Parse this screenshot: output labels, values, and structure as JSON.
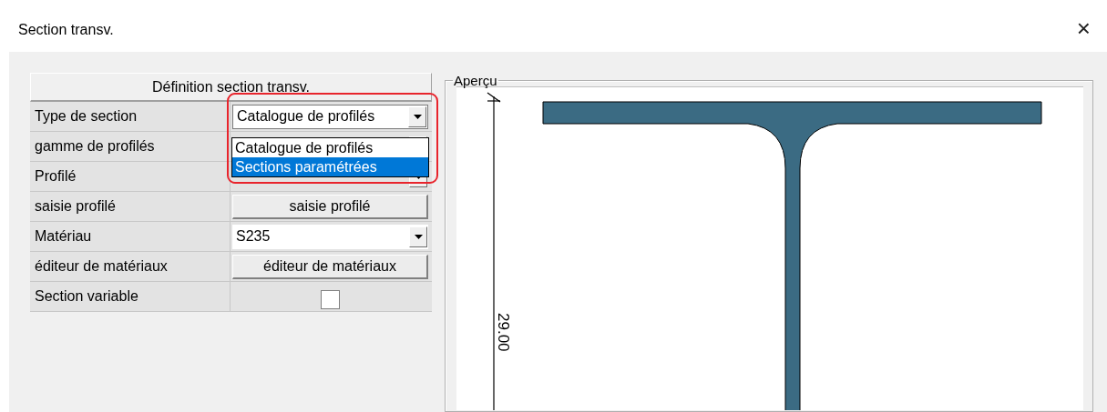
{
  "window": {
    "title": "Section transv.",
    "close": "×"
  },
  "definition": {
    "header": "Définition section transv.",
    "rows": [
      {
        "label": "Type de section",
        "kind": "combo",
        "value": "Catalogue de profilés",
        "expanded": true,
        "options": [
          {
            "label": "Catalogue de profilés",
            "highlighted": false
          },
          {
            "label": "Sections paramétrées",
            "highlighted": true
          }
        ]
      },
      {
        "label": "gamme de profilés",
        "kind": "combo"
      },
      {
        "label": "Profilé",
        "kind": "combo"
      },
      {
        "label": "saisie profilé",
        "kind": "button",
        "value": "saisie profilé"
      },
      {
        "label": "Matériau",
        "kind": "combo",
        "value": "S235",
        "expanded": false
      },
      {
        "label": "éditeur de matériaux",
        "kind": "button",
        "value": "éditeur de matériaux"
      },
      {
        "label": "Section variable",
        "kind": "checkbox",
        "checked": false
      }
    ]
  },
  "preview": {
    "title": "Aperçu",
    "dimension": "29.00"
  }
}
